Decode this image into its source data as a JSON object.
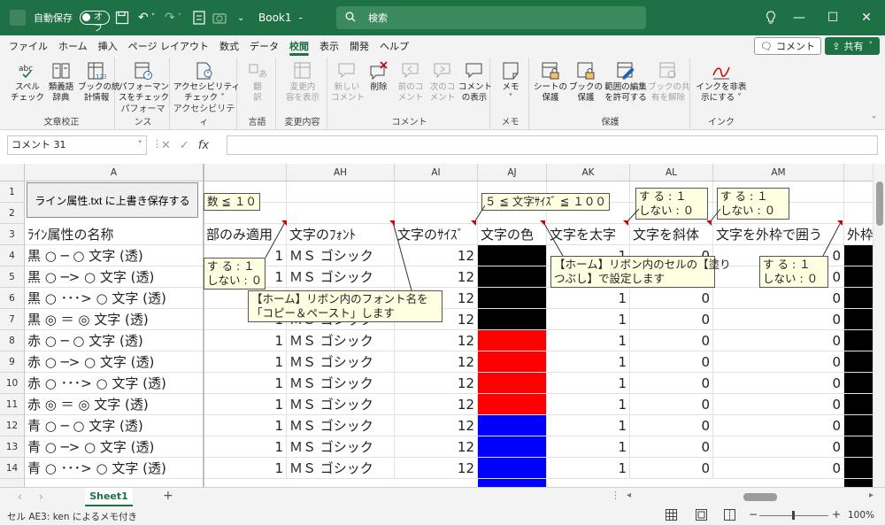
{
  "titlebar": {
    "autosave_label": "自動保存",
    "autosave_state": "オフ",
    "filename": "Book1",
    "filename_suffix": "-",
    "search_placeholder": "検索",
    "bg_color": "#1e7145"
  },
  "tabs": [
    "ファイル",
    "ホーム",
    "挿入",
    "ページ レイアウト",
    "数式",
    "データ",
    "校閲",
    "表示",
    "開発",
    "ヘルプ"
  ],
  "active_tab": "校閲",
  "header_buttons": {
    "comment": "コメント",
    "share": "共有"
  },
  "ribbon": {
    "groups": [
      {
        "label": "文章校正",
        "buttons": [
          {
            "l1": "スペル",
            "l2": "チェック",
            "icon": "abc-spell-icon"
          },
          {
            "l1": "類義語",
            "l2": "辞典",
            "icon": "thesaurus-icon"
          },
          {
            "l1": "ブックの統",
            "l2": "計情報",
            "icon": "workbook-stats-icon"
          }
        ]
      },
      {
        "label": "パフォーマンス",
        "buttons": [
          {
            "l1": "パフォーマン",
            "l2": "スをチェック",
            "icon": "performance-icon"
          }
        ]
      },
      {
        "label": "アクセシビリティ",
        "buttons": [
          {
            "l1": "アクセシビリティ",
            "l2": "チェック ˅",
            "icon": "accessibility-icon"
          }
        ]
      },
      {
        "label": "言語",
        "buttons": [
          {
            "l1": "翻",
            "l2": "訳",
            "icon": "translate-icon"
          }
        ]
      },
      {
        "label": "変更内容",
        "buttons": [
          {
            "l1": "変更内",
            "l2": "容を表示",
            "icon": "changes-icon"
          }
        ]
      },
      {
        "label": "コメント",
        "buttons": [
          {
            "l1": "新しい",
            "l2": "コメント",
            "icon": "new-comment-icon"
          },
          {
            "l1": "削除",
            "l2": "",
            "icon": "delete-comment-icon"
          },
          {
            "l1": "前のコ",
            "l2": "メント",
            "icon": "prev-comment-icon"
          },
          {
            "l1": "次のコ",
            "l2": "メント",
            "icon": "next-comment-icon"
          },
          {
            "l1": "コメント",
            "l2": "の表示",
            "icon": "show-comments-icon"
          }
        ]
      },
      {
        "label": "メモ",
        "buttons": [
          {
            "l1": "メモ",
            "l2": "˅",
            "icon": "note-icon"
          }
        ]
      },
      {
        "label": "保護",
        "buttons": [
          {
            "l1": "シートの",
            "l2": "保護",
            "icon": "protect-sheet-icon"
          },
          {
            "l1": "ブックの",
            "l2": "保護",
            "icon": "protect-workbook-icon"
          },
          {
            "l1": "範囲の編集",
            "l2": "を許可する",
            "icon": "allow-edit-ranges-icon"
          },
          {
            "l1": "ブックの共",
            "l2": "有を解除",
            "icon": "unshare-workbook-icon"
          }
        ]
      },
      {
        "label": "インク",
        "buttons": [
          {
            "l1": "インクを非表",
            "l2": "示にする ˅",
            "icon": "ink-icon"
          }
        ]
      }
    ]
  },
  "formula_bar": {
    "name_box": "コメント 31",
    "fx": "fx",
    "formula": ""
  },
  "columns": [
    "A",
    "AH",
    "AI",
    "AJ",
    "AK",
    "AL",
    "AM"
  ],
  "rows": [
    "1",
    "2",
    "3",
    "4",
    "5",
    "6",
    "7",
    "8",
    "9",
    "10",
    "11",
    "12",
    "13",
    "14"
  ],
  "save_button": "ライン属性.txt に上書き保存する",
  "row3_headers": {
    "a": "ﾗｲﾝ属性の名称",
    "ag": "部のみ適用",
    "ah": "文字のﾌｫﾝﾄ",
    "ai": "文字のｻｲｽﾞ",
    "aj": "文字の色",
    "ak": "文字を太字",
    "al": "文字を斜体",
    "am": "文字を外枠で囲う",
    "an": "外枠"
  },
  "data_rows": [
    {
      "name": "黒 ○ ─ ○ 文字 (透)",
      "ag": "1",
      "font": "ＭＳ ゴシック",
      "size": "12",
      "color": "#000000",
      "bold": "1",
      "italic": "0",
      "frame": "0"
    },
    {
      "name": "黒 ○ ─> ○ 文字 (透)",
      "ag": "1",
      "font": "ＭＳ ゴシック",
      "size": "12",
      "color": "#000000",
      "bold": "1",
      "italic": "0",
      "frame": "0"
    },
    {
      "name": "黒 ○ ･･･> ○ 文字 (透)",
      "ag": "1",
      "font": "ＭＳ ゴシック",
      "size": "12",
      "color": "#000000",
      "bold": "1",
      "italic": "0",
      "frame": "0"
    },
    {
      "name": "黒 ◎ ＝ ◎ 文字 (透)",
      "ag": "1",
      "font": "ＭＳ ゴシック",
      "size": "12",
      "color": "#000000",
      "bold": "1",
      "italic": "0",
      "frame": "0"
    },
    {
      "name": "赤 ○ ─ ○ 文字 (透)",
      "ag": "1",
      "font": "ＭＳ ゴシック",
      "size": "12",
      "color": "#ff0000",
      "bold": "1",
      "italic": "0",
      "frame": "0"
    },
    {
      "name": "赤 ○ ─> ○ 文字 (透)",
      "ag": "1",
      "font": "ＭＳ ゴシック",
      "size": "12",
      "color": "#ff0000",
      "bold": "1",
      "italic": "0",
      "frame": "0"
    },
    {
      "name": "赤 ○ ･･･> ○ 文字 (透)",
      "ag": "1",
      "font": "ＭＳ ゴシック",
      "size": "12",
      "color": "#ff0000",
      "bold": "1",
      "italic": "0",
      "frame": "0"
    },
    {
      "name": "赤 ◎ ＝ ◎ 文字 (透)",
      "ag": "1",
      "font": "ＭＳ ゴシック",
      "size": "12",
      "color": "#ff0000",
      "bold": "1",
      "italic": "0",
      "frame": "0"
    },
    {
      "name": "青 ○ ─ ○ 文字 (透)",
      "ag": "1",
      "font": "ＭＳ ゴシック",
      "size": "12",
      "color": "#0000ff",
      "bold": "1",
      "italic": "0",
      "frame": "0"
    },
    {
      "name": "青 ○ ─> ○ 文字 (透)",
      "ag": "1",
      "font": "ＭＳ ゴシック",
      "size": "12",
      "color": "#0000ff",
      "bold": "1",
      "italic": "0",
      "frame": "0"
    },
    {
      "name": "青 ○ ･･･> ○ 文字 (透)",
      "ag": "1",
      "font": "ＭＳ ゴシック",
      "size": "12",
      "color": "#0000ff",
      "bold": "1",
      "italic": "0",
      "frame": "0"
    }
  ],
  "notes": {
    "count_note": "数 ≦ １０",
    "size_note": "５ ≦ 文字ｻｲｽﾞ ≦ １００",
    "bold_note_1": "す る : １",
    "bold_note_2": "しない : ０",
    "italic_note_1": "す る : １",
    "italic_note_2": "しない : ０",
    "apply_note_1": "す る : １",
    "apply_note_2": "しない : ０",
    "frame_note_1": "す る : １",
    "frame_note_2": "しない : ０",
    "font_note": "【ホーム】リボン内のフォント名を\n「コピー＆ペースト」します",
    "color_note": "【ホーム】リボン内のセルの【塗り\nつぶし】で設定します"
  },
  "sheet_tabs": {
    "sheet": "Sheet1",
    "add": "+"
  },
  "status": {
    "text": "セル AE3: ken によるメモ付き",
    "zoom": "100%"
  }
}
